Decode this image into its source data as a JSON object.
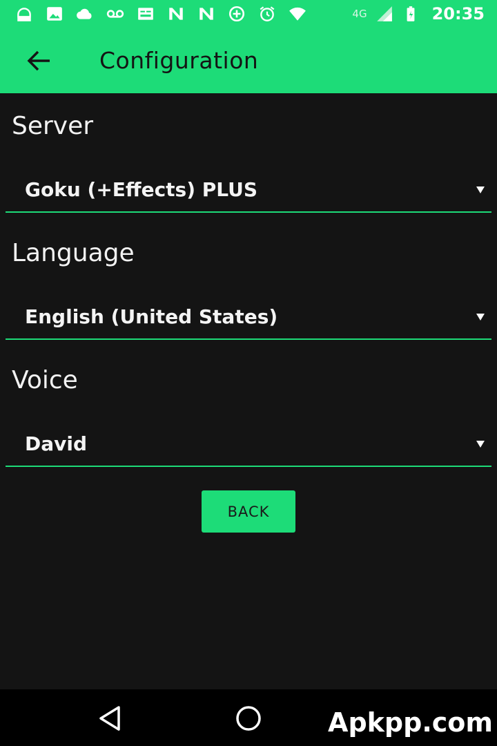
{
  "status_bar": {
    "icons": [
      "news-icon",
      "image-icon",
      "cloud-icon",
      "voicemail-icon",
      "keyboard-icon",
      "n-app-icon",
      "n-app-icon",
      "data-saver-icon",
      "alarm-icon",
      "wifi-icon"
    ],
    "network_type": "4G",
    "time": "20:35"
  },
  "app_bar": {
    "title": "Configuration",
    "back_icon": "arrow-left-icon"
  },
  "settings": {
    "server": {
      "label": "Server",
      "value": "Goku (+Effects) PLUS"
    },
    "language": {
      "label": "Language",
      "value": "English (United States)"
    },
    "voice": {
      "label": "Voice",
      "value": "David"
    }
  },
  "actions": {
    "back_label": "BACK"
  },
  "navigation": {
    "back_icon": "triangle-back-icon",
    "home_icon": "circle-home-icon"
  },
  "watermark": {
    "text": "Apkpp.com"
  },
  "colors": {
    "accent": "#1ddc78",
    "background": "#141414"
  }
}
